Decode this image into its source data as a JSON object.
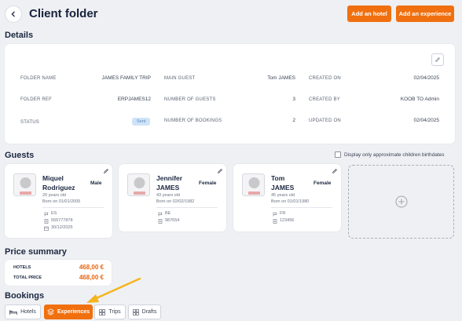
{
  "header": {
    "title": "Client folder",
    "add_hotel_label": "Add an hotel",
    "add_experience_label": "Add an experience"
  },
  "details": {
    "section_title": "Details",
    "rows": [
      {
        "label": "FOLDER NAME",
        "value": "JAMES FAMILY TRIP"
      },
      {
        "label": "FOLDER REF",
        "value": "ERPJAMES12"
      },
      {
        "label": "STATUS",
        "value": "Sent"
      },
      {
        "label": "MAIN GUEST",
        "value": "Tom JAMES"
      },
      {
        "label": "NUMBER OF GUESTS",
        "value": "3"
      },
      {
        "label": "NUMBER OF BOOKINGS",
        "value": "2"
      },
      {
        "label": "CREATED ON",
        "value": "02/04/2025"
      },
      {
        "label": "CREATED BY",
        "value": "KOOB TO Admin"
      },
      {
        "label": "UPDATED ON",
        "value": "02/04/2025"
      }
    ]
  },
  "guests": {
    "section_title": "Guests",
    "approx_checkbox_label": "Display only approximate children birthdates",
    "list": [
      {
        "first": "Miquel",
        "last": "Rodriguez",
        "gender": "Male",
        "age": "20 years old",
        "born": "Born on 01/01/2005",
        "nationality": "ES",
        "passport": "555777878",
        "expiry": "30/12/2025"
      },
      {
        "first": "Jennifer",
        "last": "JAMES",
        "gender": "Female",
        "age": "43 years old",
        "born": "Born on 02/02/1982",
        "nationality": "BE",
        "passport": "987654"
      },
      {
        "first": "Tom",
        "last": "JAMES",
        "gender": "Female",
        "age": "45 years old",
        "born": "Born on 01/01/1980",
        "nationality": "FR",
        "passport": "123456"
      }
    ]
  },
  "price_summary": {
    "section_title": "Price summary",
    "hotels_label": "HOTELS",
    "hotels_value": "468,00 €",
    "total_label": "TOTAL PRICE",
    "total_value": "468,00 €"
  },
  "bookings": {
    "section_title": "Bookings",
    "tabs": [
      {
        "label": "Hotels",
        "icon": "bed-icon"
      },
      {
        "label": "Experiences",
        "icon": "layers-icon"
      },
      {
        "label": "Trips",
        "icon": "grid-icon"
      },
      {
        "label": "Drafts",
        "icon": "grid-icon"
      }
    ],
    "active_tab": "Experiences"
  },
  "colors": {
    "accent": "#f0700f",
    "price": "#e9650f",
    "badge_bg": "#cfe3f8",
    "annotation_arrow": "#f5b41c"
  }
}
